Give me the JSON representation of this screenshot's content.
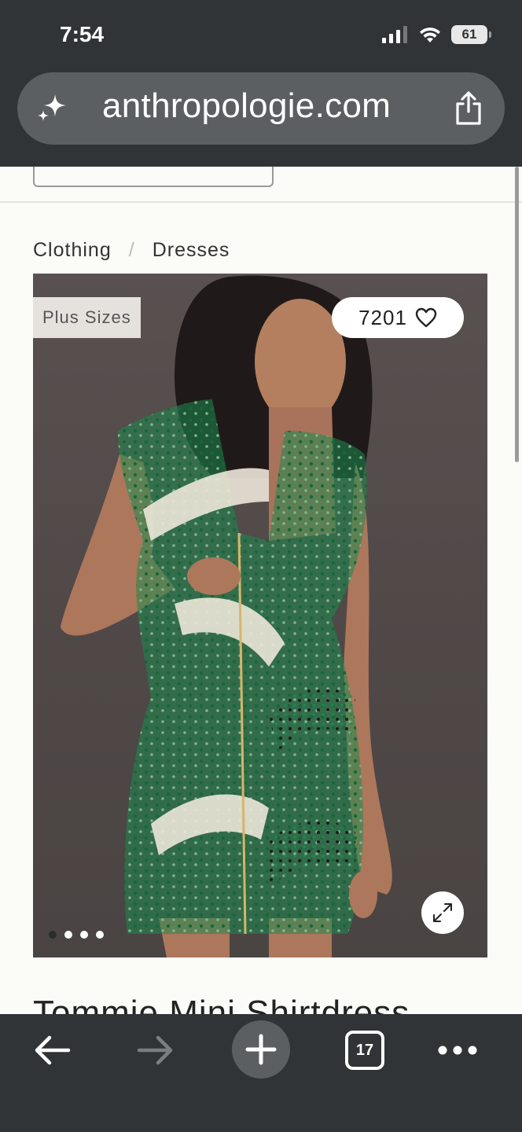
{
  "status_bar": {
    "time": "7:54",
    "battery": "61",
    "icons": [
      "cellular-signal-icon",
      "wifi-icon",
      "battery-icon"
    ]
  },
  "browser": {
    "url": "anthropologie.com",
    "icons": [
      "sparkle-icon",
      "share-icon"
    ]
  },
  "breadcrumb": {
    "items": [
      "Clothing",
      "Dresses"
    ],
    "separator": "/"
  },
  "product": {
    "badge": "Plus Sizes",
    "favorites_count": "7201",
    "image_dots": 4,
    "active_dot": 0,
    "title": "Tommie Mini Shirtdress",
    "colors": {
      "dress_green": "#1e8a4e",
      "dress_cream": "#ece7d9",
      "background": "#524a49"
    }
  },
  "toolbar": {
    "tabs_count": "17",
    "icons": [
      "back-arrow-icon",
      "forward-arrow-icon",
      "new-tab-plus-icon",
      "tabs-icon",
      "more-icon"
    ]
  }
}
